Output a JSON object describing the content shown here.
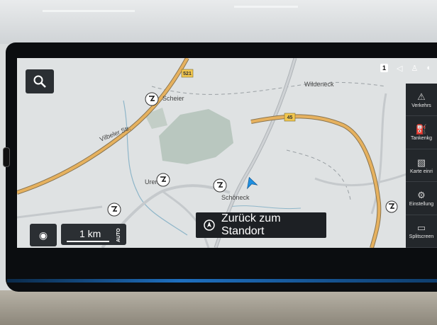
{
  "status_bar": {
    "counter": "1",
    "icons": [
      "speaker-icon",
      "user-icon",
      "globe-icon"
    ]
  },
  "map": {
    "place_labels": [
      "Scheier",
      "Wildeneck",
      "Vilbeler Str.",
      "Uren",
      "Schöneck"
    ],
    "road_shields": [
      "521",
      "45"
    ],
    "colors": {
      "land": "#dfe2e3",
      "forest": "#b9c7bf",
      "major_road": "#e6b15e",
      "road": "#b8bdc1",
      "water": "#8fb6c9",
      "position": "#1f8fe0"
    }
  },
  "side_menu": {
    "items": [
      {
        "label": "Verkehrs",
        "icon": "traffic-icon"
      },
      {
        "label": "Tankenkg",
        "icon": "fuel-icon"
      },
      {
        "label": "Karte einri",
        "icon": "map-settings-icon"
      },
      {
        "label": "Einstellung",
        "icon": "gear-icon"
      },
      {
        "label": "Splitscreen",
        "icon": "splitscreen-icon"
      }
    ]
  },
  "scale": {
    "value": "1 km",
    "mode": "AUTO"
  },
  "back_button": {
    "label": "Zurück zum Standort"
  }
}
